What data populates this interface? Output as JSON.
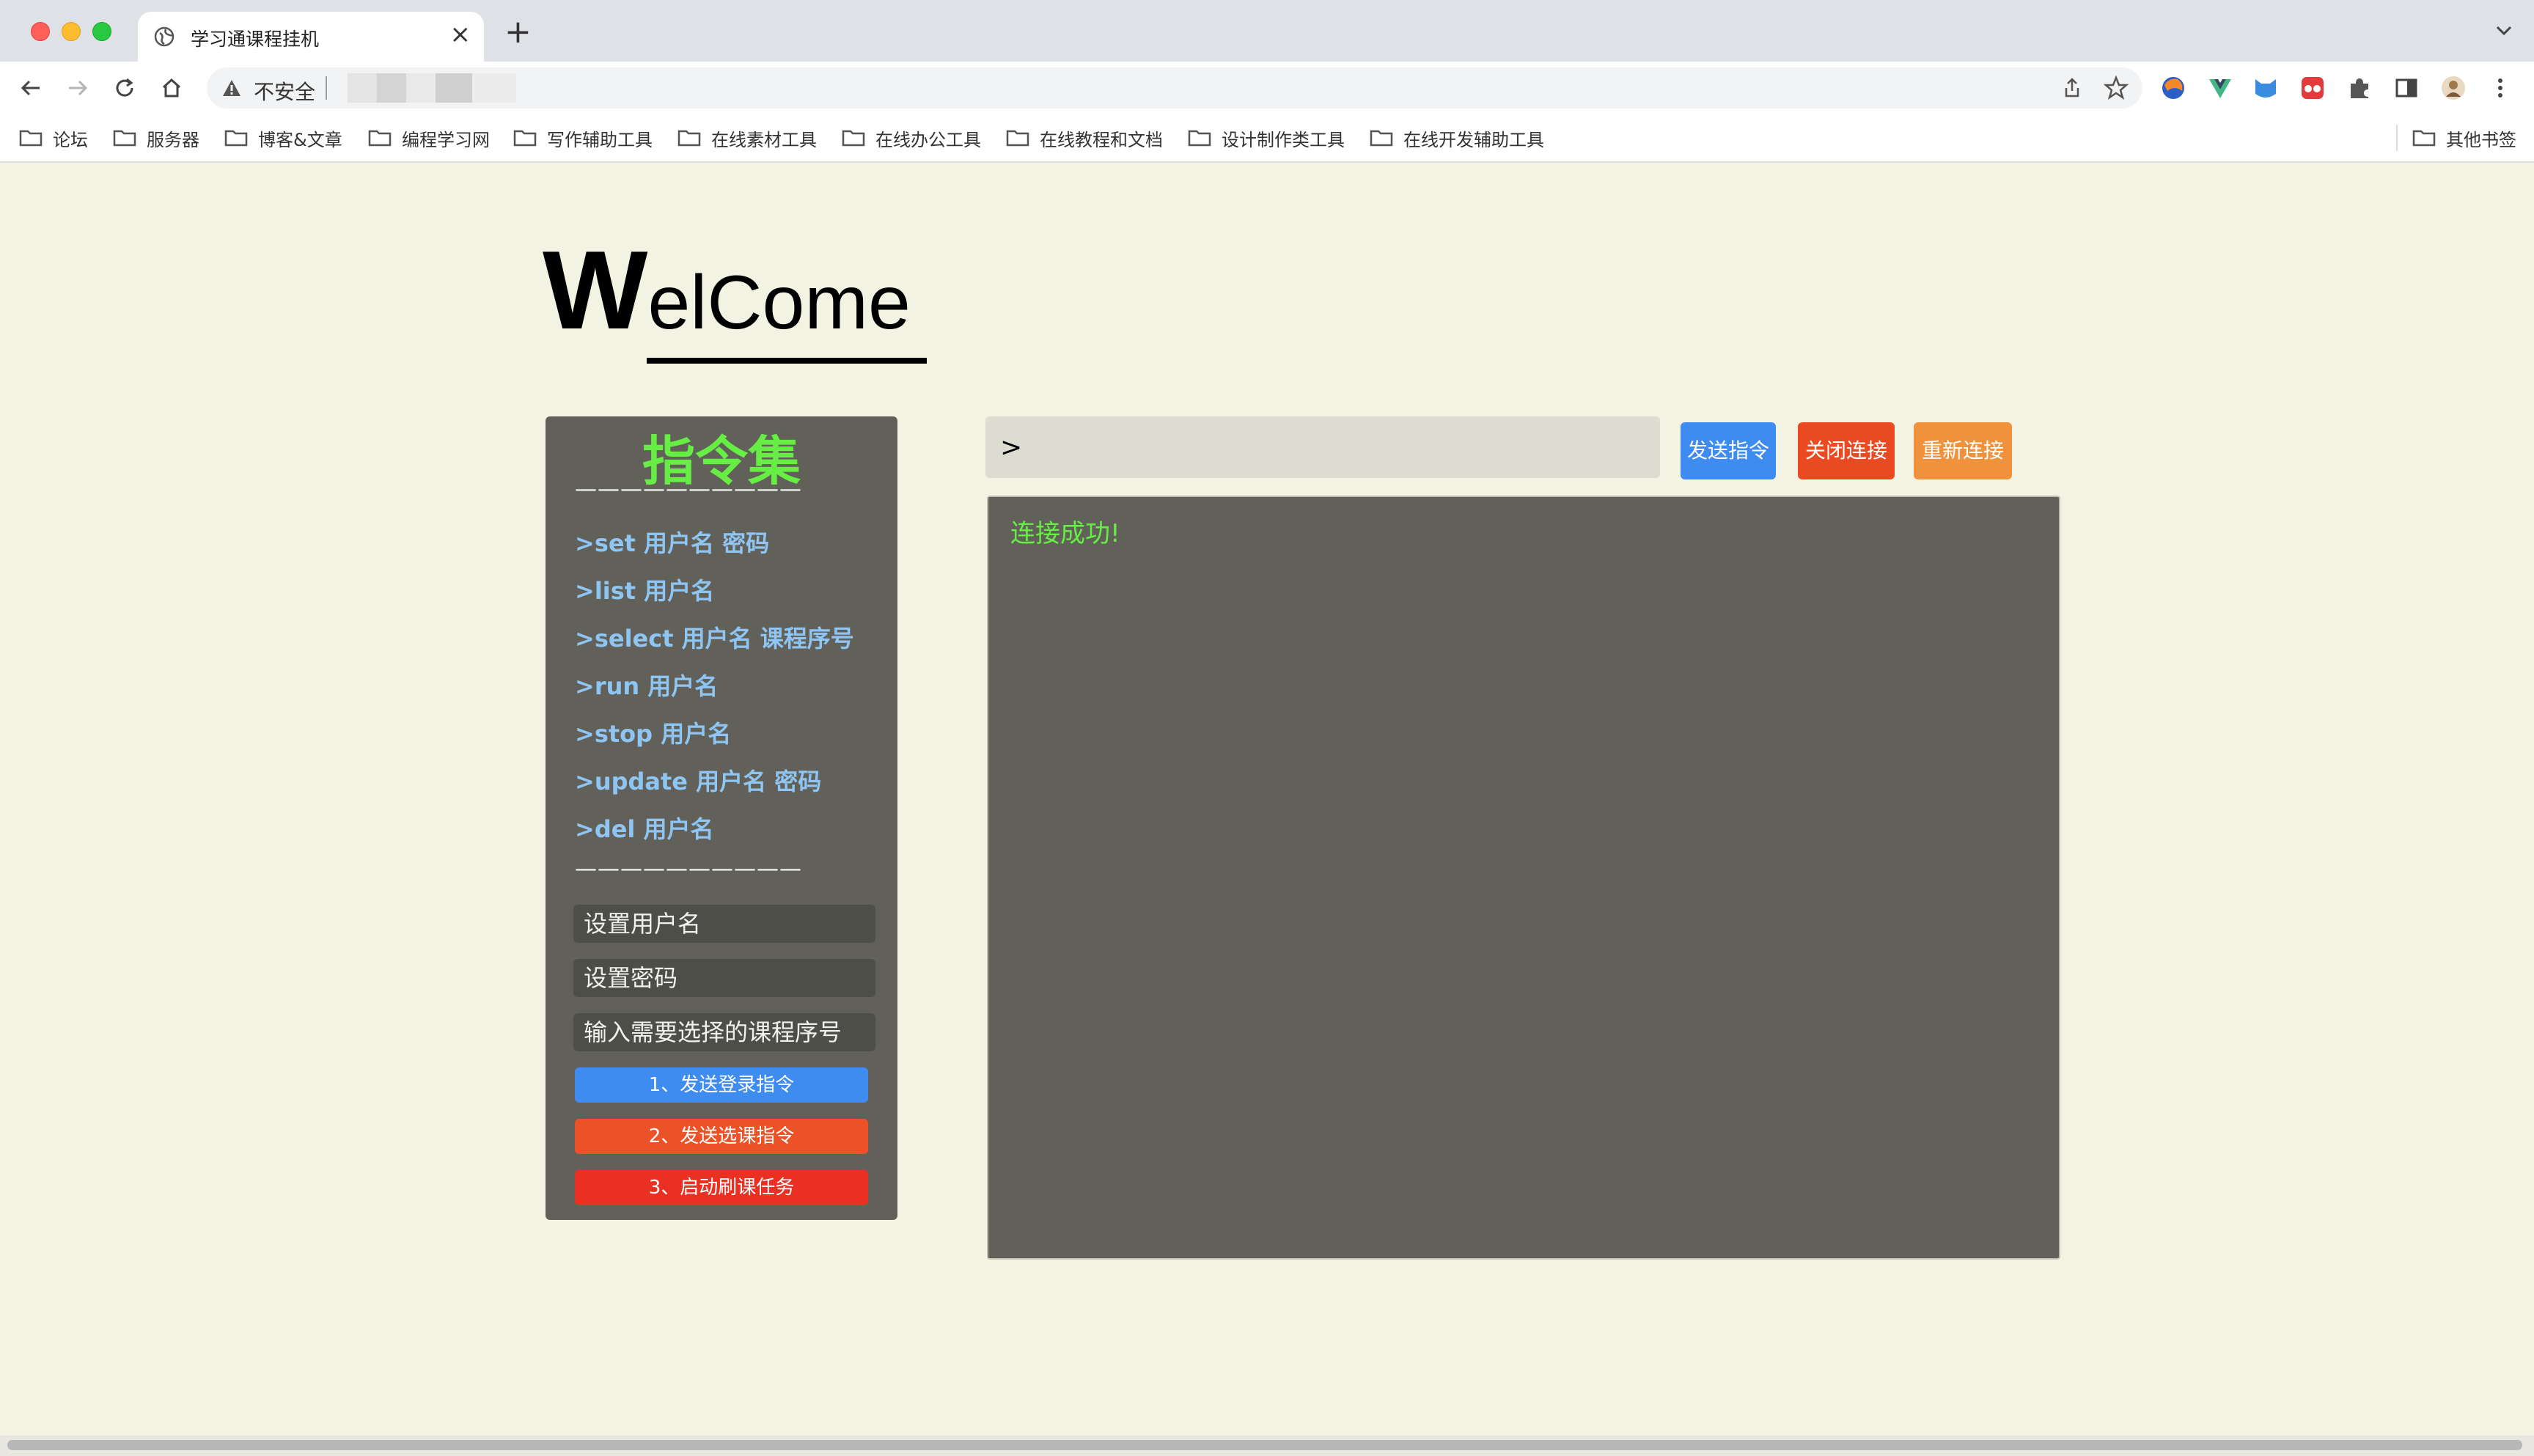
{
  "browser": {
    "tab_title": "学习通课程挂机",
    "address_security": "不安全",
    "bookmarks": [
      "论坛",
      "服务器",
      "博客&文章",
      "编程学习网",
      "写作辅助工具",
      "在线素材工具",
      "在线办公工具",
      "在线教程和文档",
      "设计制作类工具",
      "在线开发辅助工具"
    ],
    "other_bookmarks": "其他书签"
  },
  "page": {
    "welcome_first": "W",
    "welcome_rest": "elCome",
    "panel": {
      "title": "指令集",
      "divider": "——————————",
      "commands": [
        ">set 用户名 密码",
        ">list 用户名",
        ">select 用户名 课程序号",
        ">run 用户名",
        ">stop 用户名",
        ">update 用户名 密码",
        ">del 用户名"
      ],
      "inputs": {
        "username_placeholder": "设置用户名",
        "password_placeholder": "设置密码",
        "course_placeholder": "输入需要选择的课程序号"
      },
      "buttons": {
        "login": "1、发送登录指令",
        "select": "2、发送选课指令",
        "start": "3、启动刷课任务"
      }
    },
    "terminal": {
      "input_value": ">",
      "send_label": "发送指令",
      "close_label": "关闭连接",
      "reconnect_label": "重新连接",
      "output": "连接成功!"
    }
  },
  "colors": {
    "page_bg": "#f3f3e4",
    "panel_bg": "#61615a",
    "title_green": "#66ee44",
    "command_blue": "#8ec5f3",
    "btn_blue": "#3f8cf0",
    "btn_orange_red": "#ec5227",
    "btn_red": "#ea3023",
    "btn_orange": "#f0913c"
  }
}
